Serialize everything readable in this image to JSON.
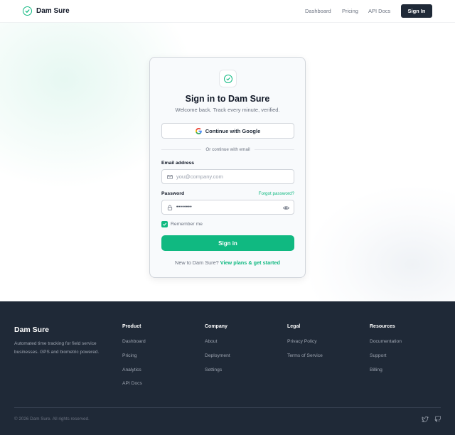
{
  "header": {
    "brand": "Dam Sure",
    "nav": [
      "Dashboard",
      "Pricing",
      "API Docs"
    ],
    "signin_label": "Sign In"
  },
  "card": {
    "title": "Sign in to Dam Sure",
    "subtitle": "Welcome back. Track every minute, verified.",
    "google_label": "Continue with Google",
    "divider_text": "Or continue with email",
    "email_label": "Email address",
    "email_placeholder": "you@company.com",
    "password_label": "Password",
    "forgot_label": "Forgot password?",
    "password_value": "••••••••",
    "remember_label": "Remember me",
    "remember_checked": true,
    "signin_label": "Sign in",
    "signup_prompt": "New to Dam Sure?",
    "signup_link": "View plans & get started"
  },
  "footer": {
    "brand": "Dam Sure",
    "description": "Automated time tracking for field service businesses. GPS and biometric powered.",
    "columns": [
      {
        "title": "Product",
        "links": [
          "Dashboard",
          "Pricing",
          "Analytics",
          "API Docs"
        ]
      },
      {
        "title": "Company",
        "links": [
          "About",
          "Deployment",
          "Settings"
        ]
      },
      {
        "title": "Legal",
        "links": [
          "Privacy Policy",
          "Terms of Service"
        ]
      },
      {
        "title": "Resources",
        "links": [
          "Documentation",
          "Support",
          "Billing"
        ]
      }
    ],
    "copyright": "© 2026 Dam Sure. All rights reserved.",
    "social_icons": [
      "twitter-icon",
      "github-icon"
    ]
  },
  "colors": {
    "accent": "#10b981",
    "dark": "#1f2937",
    "muted": "#6b7280"
  }
}
